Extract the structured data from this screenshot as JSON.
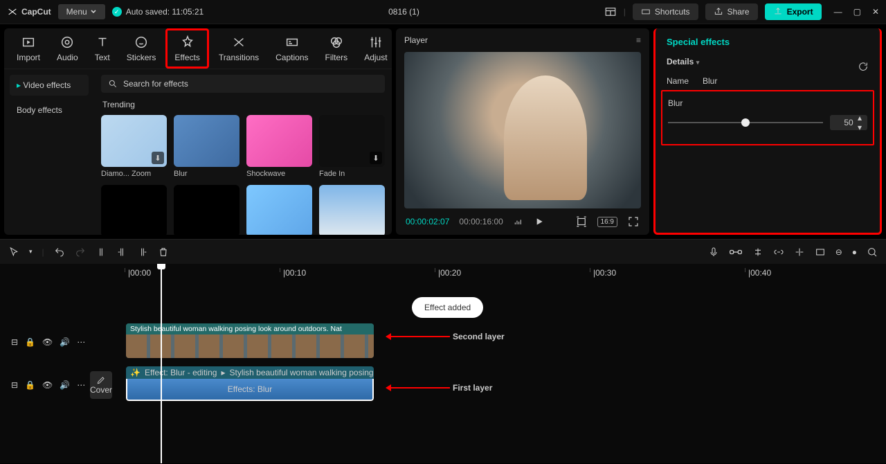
{
  "app": {
    "name": "CapCut",
    "menu": "Menu",
    "autosave": "Auto saved: 11:05:21",
    "title": "0816 (1)"
  },
  "titlebar_buttons": {
    "shortcuts": "Shortcuts",
    "share": "Share",
    "export": "Export"
  },
  "media_tabs": [
    "Import",
    "Audio",
    "Text",
    "Stickers",
    "Effects",
    "Transitions",
    "Captions",
    "Filters",
    "Adjust"
  ],
  "media_tabs_active_index": 4,
  "effects_sidebar": {
    "video": "Video effects",
    "body": "Body effects"
  },
  "search": {
    "placeholder": "Search for effects"
  },
  "effects_section": "Trending",
  "effects": [
    {
      "label": "Diamo... Zoom"
    },
    {
      "label": "Blur"
    },
    {
      "label": "Shockwave"
    },
    {
      "label": "Fade In"
    }
  ],
  "player": {
    "title": "Player",
    "current": "00:00:02:07",
    "duration": "00:00:16:00",
    "ratio_badge": "16:9"
  },
  "props": {
    "panel_title": "Special effects",
    "details": "Details",
    "name_label": "Name",
    "name_value": "Blur",
    "slider_label": "Blur",
    "slider_value": 50,
    "slider_min": 0,
    "slider_max": 100
  },
  "timeline": {
    "ruler": [
      "|00:00",
      "|00:10",
      "|00:20",
      "|00:30",
      "|00:40"
    ],
    "toast": "Effect added",
    "clip1_title": "Stylish beautiful woman walking posing look around outdoors. Nat",
    "clip2_effect": "Effect: Blur - editing",
    "clip2_title": "Stylish beautiful woman walking posing l",
    "clip2_overlay": "Effects:   Blur",
    "cover_btn": "Cover",
    "annotation_second": "Second layer",
    "annotation_first": "First layer"
  }
}
